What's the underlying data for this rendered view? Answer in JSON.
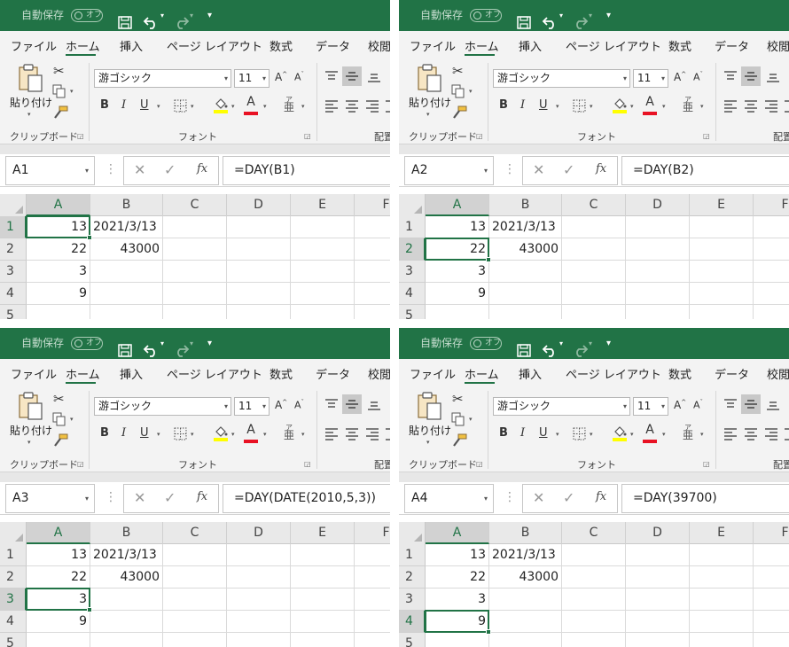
{
  "titlebar": {
    "autosave_label": "自動保存",
    "autosave_state": "オフ"
  },
  "tabs": [
    "ファイル",
    "ホーム",
    "挿入",
    "ページ レイアウト",
    "数式",
    "データ",
    "校閲"
  ],
  "ribbon": {
    "paste_label": "貼り付け",
    "clipboard_label": "クリップボード",
    "font_name": "游ゴシック",
    "font_size": "11",
    "font_group_label": "フォント",
    "align_group_label": "配置",
    "bold": "B",
    "italic": "I",
    "underline": "U",
    "grow_font": "A",
    "shrink_font": "A",
    "font_color_letter": "A",
    "phonetic": "亜",
    "phonetic_top": "ア"
  },
  "formula_bar": {
    "cancel": "✕",
    "enter": "✓",
    "fx": "fx"
  },
  "columns": [
    "A",
    "B",
    "C",
    "D",
    "E",
    "F"
  ],
  "rows": [
    "1",
    "2",
    "3",
    "4",
    "5"
  ],
  "cells": {
    "A1": "13",
    "B1": "2021/3/13",
    "A2": "22",
    "B2": "43000",
    "A3": "3",
    "A4": "9"
  },
  "accent_color": "#217346",
  "panels": [
    {
      "name_box": "A1",
      "formula": "=DAY(B1)"
    },
    {
      "name_box": "A2",
      "formula": "=DAY(B2)"
    },
    {
      "name_box": "A3",
      "formula": "=DAY(DATE(2010,5,3))"
    },
    {
      "name_box": "A4",
      "formula": "=DAY(39700)"
    }
  ]
}
